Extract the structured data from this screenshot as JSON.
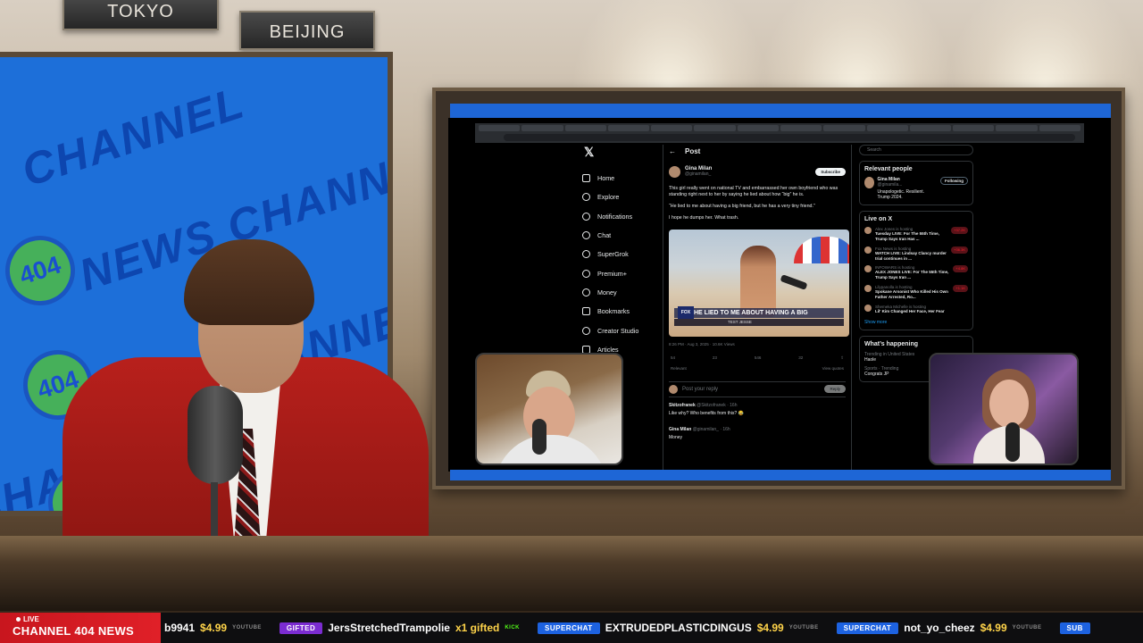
{
  "studio": {
    "clock_labels": [
      "TOKYO",
      "BEIJING"
    ],
    "wall_text": [
      "CHANNEL",
      "NEWS CHANNEL",
      "NEWS CHANNEL",
      "CHANNEL"
    ],
    "wall_logo": "404"
  },
  "browser": {
    "tab_count": 14
  },
  "x_nav": {
    "items": [
      "Home",
      "Explore",
      "Notifications",
      "Chat",
      "SuperGrok",
      "Premium+",
      "Money",
      "Bookmarks",
      "Creator Studio",
      "Articles"
    ]
  },
  "post": {
    "header": "Post",
    "author_name": "Gina Milan",
    "author_handle": "@ginamilan_",
    "subscribe_label": "Subscribe",
    "text_1": "This girl really went on national TV and embarrassed her own boyfriend who was standing right next to her by saying he lied about how “big” he is.",
    "text_2": "“He lied to me about having a big friend, but he has a very tiny friend.”",
    "text_3": "I hope he dumps her. What trash.",
    "video_caption": "HE LIED TO ME ABOUT HAVING A BIG",
    "video_logo": "FOX",
    "video_subline": "TEST JESSE",
    "meta": "8:26 PM · Aug 3, 2025 · 10.6K Views",
    "counts": [
      "54",
      "23",
      "546",
      "32"
    ],
    "relevant": "Relevant",
    "view_quotes": "View quotes",
    "reply_placeholder": "Post your reply",
    "reply_button": "Reply",
    "replies": [
      {
        "name": "Skitzofranek",
        "handle": "@Skitzofranek · 16h",
        "text": "Like why? Who benefits from this? 😂"
      },
      {
        "name": "Gina Milan",
        "handle": "@ginamilan_ · 16h",
        "text": "Money"
      }
    ]
  },
  "right_col": {
    "search_placeholder": "Search",
    "relevant_title": "Relevant people",
    "rp_name": "Gina Milan",
    "rp_handle": "@ginamila...",
    "rp_bio": "Unapologetic. Resilient. Trump 2024.",
    "follow_label": "Following",
    "live_title": "Live on X",
    "live_items": [
      {
        "source": "Alex Jones",
        "status": "is hosting",
        "title": "Tuesday LIVE: For The 55th Time, Trump Says Iran Has ...",
        "count": "+37.2K"
      },
      {
        "source": "Fox News",
        "status": "is hosting",
        "title": "WATCH LIVE: Lindsay Clancy murder trial continues in ...",
        "count": "+36.3K"
      },
      {
        "source": "INFOWARS",
        "status": "is hosting",
        "title": "ALEX JONES LIVE: For The 55th Time, Trump Says Iran ...",
        "count": "+4.8K"
      },
      {
        "source": "Lilypanolla",
        "status": "is hosting",
        "title": "Spokane Arsonist Who Killed His Own Father Arrested, Ro...",
        "count": "+1.1K"
      },
      {
        "source": "Shemeka Michelle",
        "status": "is hosting",
        "title": "Lil' Kim Changed Her Face, Her Fear",
        "count": ""
      }
    ],
    "show_more": "Show more",
    "happening_title": "What’s happening",
    "trends": [
      {
        "context": "Trending in United States",
        "name": "Haole"
      },
      {
        "context": "Sports · Trending",
        "name": "Congrats JP"
      }
    ]
  },
  "ticker": {
    "live_label": "LIVE",
    "brand": "CHANNEL 404 NEWS",
    "items": [
      {
        "badge": "",
        "name": "b9941",
        "amount": "$4.99",
        "source": "YOUTUBE"
      },
      {
        "badge": "GIFTED",
        "name": "JersStretchedTrampolie",
        "amount": "x1 gifted",
        "source": "KICK"
      },
      {
        "badge": "SUPERCHAT",
        "name": "EXTRUDEDPLASTICDINGUS",
        "amount": "$4.99",
        "source": "YOUTUBE"
      },
      {
        "badge": "SUPERCHAT",
        "name": "not_yo_cheez",
        "amount": "$4.99",
        "source": "YOUTUBE"
      },
      {
        "badge": "SUB",
        "name": "",
        "amount": "",
        "source": ""
      }
    ]
  },
  "colors": {
    "accent_red": "#c8161e",
    "wall_blue": "#1d6fd9",
    "superchat_blue": "#1d62e0",
    "gifted_purple": "#7b2cd1",
    "amount_yellow": "#ffd44a",
    "x_link_blue": "#1d9bf0"
  }
}
